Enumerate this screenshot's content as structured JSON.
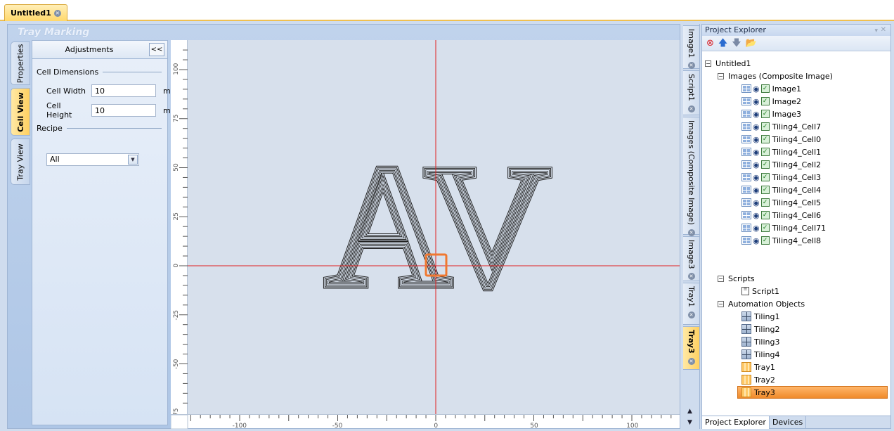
{
  "document_tab": {
    "label": "Untitled1"
  },
  "workspace": {
    "title": "Tray Marking"
  },
  "left_tabs": [
    {
      "label": "Properties",
      "active": false
    },
    {
      "label": "Cell View",
      "active": true
    },
    {
      "label": "Tray View",
      "active": false
    }
  ],
  "adjustments": {
    "title": "Adjustments",
    "collapse_label": "<<",
    "cell_dimensions": {
      "heading": "Cell Dimensions",
      "width_label": "Cell Width",
      "width_value": "10",
      "height_label": "Cell Height",
      "height_value": "10",
      "unit": "mm"
    },
    "recipe": {
      "heading": "Recipe",
      "selected": "All"
    }
  },
  "canvas": {
    "text": "AV",
    "ruler_x_labels": [
      "-100",
      "-50",
      "0",
      "50",
      "100"
    ],
    "ruler_y_labels": [
      "100",
      "75",
      "50",
      "25",
      "0",
      "-25",
      "-50",
      "-75"
    ],
    "axis_color": "#e02020",
    "marker_color": "#f07830"
  },
  "doc_vtabs": [
    {
      "label": "Image1",
      "active": false
    },
    {
      "label": "Script1",
      "active": false
    },
    {
      "label": "Images (Composite Image)",
      "active": false
    },
    {
      "label": "Image3",
      "active": false
    },
    {
      "label": "Tray1",
      "active": false
    },
    {
      "label": "Tray3",
      "active": true
    }
  ],
  "explorer": {
    "title": "Project Explorer",
    "root": "Untitled1",
    "images_group": "Images (Composite Image)",
    "images": [
      "Image1",
      "Image2",
      "Image3",
      "Tiling4_Cell7",
      "Tiling4_Cell0",
      "Tiling4_Cell1",
      "Tiling4_Cell2",
      "Tiling4_Cell3",
      "Tiling4_Cell4",
      "Tiling4_Cell5",
      "Tiling4_Cell6",
      "Tiling4_Cell71",
      "Tiling4_Cell8"
    ],
    "scripts_group": "Scripts",
    "scripts": [
      "Script1"
    ],
    "automation_group": "Automation Objects",
    "tilings": [
      "Tiling1",
      "Tiling2",
      "Tiling3",
      "Tiling4"
    ],
    "trays": [
      "Tray1",
      "Tray2",
      "Tray3"
    ],
    "selected": "Tray3",
    "bottom_tabs": [
      {
        "label": "Project Explorer",
        "active": true
      },
      {
        "label": "Devices",
        "active": false
      }
    ]
  }
}
